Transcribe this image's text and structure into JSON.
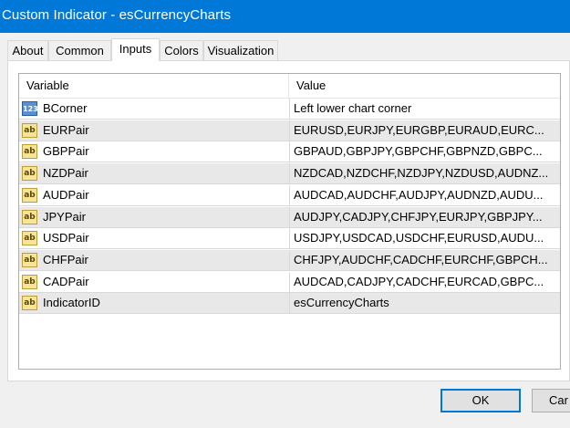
{
  "window": {
    "title": "Custom Indicator - esCurrencyCharts"
  },
  "tabs": [
    {
      "label": "About"
    },
    {
      "label": "Common"
    },
    {
      "label": "Inputs"
    },
    {
      "label": "Colors"
    },
    {
      "label": "Visualization"
    }
  ],
  "active_tab": "Inputs",
  "grid": {
    "headers": {
      "variable": "Variable",
      "value": "Value"
    },
    "rows": [
      {
        "icon": "123",
        "variable": "BCorner",
        "value": "Left lower chart corner"
      },
      {
        "icon": "ab",
        "variable": "EURPair",
        "value": "EURUSD,EURJPY,EURGBP,EURAUD,EURC..."
      },
      {
        "icon": "ab",
        "variable": "GBPPair",
        "value": "GBPAUD,GBPJPY,GBPCHF,GBPNZD,GBPC..."
      },
      {
        "icon": "ab",
        "variable": "NZDPair",
        "value": "NZDCAD,NZDCHF,NZDJPY,NZDUSD,AUDNZ..."
      },
      {
        "icon": "ab",
        "variable": "AUDPair",
        "value": "AUDCAD,AUDCHF,AUDJPY,AUDNZD,AUDU..."
      },
      {
        "icon": "ab",
        "variable": "JPYPair",
        "value": "AUDJPY,CADJPY,CHFJPY,EURJPY,GBPJPY..."
      },
      {
        "icon": "ab",
        "variable": "USDPair",
        "value": "USDJPY,USDCAD,USDCHF,EURUSD,AUDU..."
      },
      {
        "icon": "ab",
        "variable": "CHFPair",
        "value": "CHFJPY,AUDCHF,CADCHF,EURCHF,GBPCH..."
      },
      {
        "icon": "ab",
        "variable": "CADPair",
        "value": "AUDCAD,CADJPY,CADCHF,EURCAD,GBPC..."
      },
      {
        "icon": "ab",
        "variable": "IndicatorID",
        "value": "esCurrencyCharts"
      }
    ]
  },
  "buttons": {
    "ok": "OK",
    "cancel": "Car"
  },
  "colors": {
    "titlebar": "#0078d7",
    "row_alt": "#e8e8e8",
    "string_icon": "#f5e49a",
    "number_icon": "#5b8fd3"
  }
}
